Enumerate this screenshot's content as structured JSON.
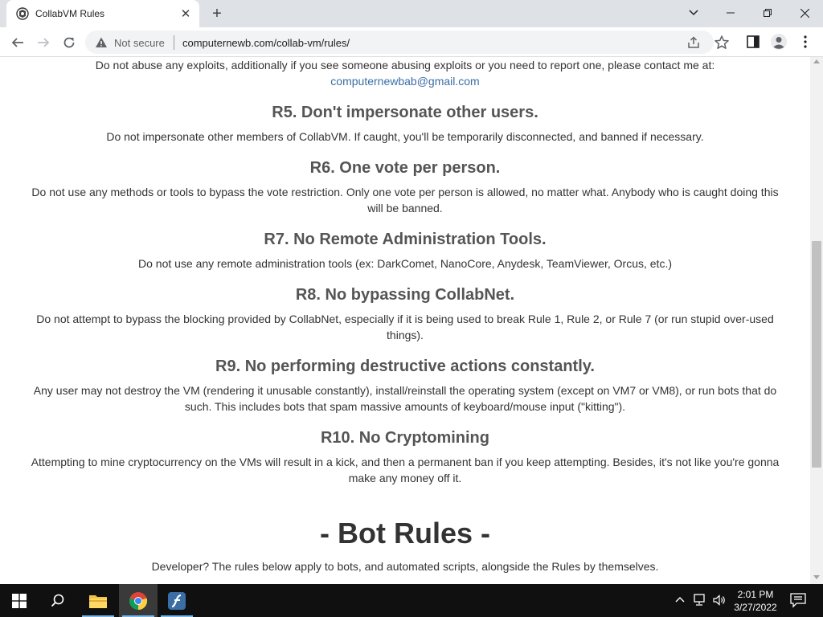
{
  "browser": {
    "tab_title": "CollabVM Rules",
    "tab_close": "✕",
    "new_tab": "+",
    "security_label": "Not secure",
    "url": "computernewb.com/collab-vm/rules/"
  },
  "page": {
    "intro_text": "Do not abuse any exploits, additionally if you see someone abusing exploits or you need to report one, please contact me at:",
    "contact_email": "computernewbab@gmail.com",
    "rules": [
      {
        "heading": "R5. Don't impersonate other users.",
        "body": "Do not impersonate other members of CollabVM. If caught, you'll be temporarily disconnected, and banned if necessary."
      },
      {
        "heading": "R6. One vote per person.",
        "body": "Do not use any methods or tools to bypass the vote restriction. Only one vote per person is allowed, no matter what. Anybody who is caught doing this will be banned."
      },
      {
        "heading": "R7. No Remote Administration Tools.",
        "body": "Do not use any remote administration tools (ex: DarkComet, NanoCore, Anydesk, TeamViewer, Orcus, etc.)"
      },
      {
        "heading": "R8. No bypassing CollabNet.",
        "body": "Do not attempt to bypass the blocking provided by CollabNet, especially if it is being used to break Rule 1, Rule 2, or Rule 7 (or run stupid over-used things)."
      },
      {
        "heading": "R9. No performing destructive actions constantly.",
        "body": "Any user may not destroy the VM (rendering it unusable constantly), install/reinstall the operating system (except on VM7 or VM8), or run bots that do such. This includes bots that spam massive amounts of keyboard/mouse input (\"kitting\")."
      },
      {
        "heading": "R10. No Cryptomining",
        "body": "Attempting to mine cryptocurrency on the VMs will result in a kick, and then a permanent ban if you keep attempting. Besides, it's not like you're gonna make any money off it."
      }
    ],
    "bot_rules_title": "- Bot Rules -",
    "bot_rules_intro": "Developer? The rules below apply to bots, and automated scripts, alongside the Rules by themselves."
  },
  "taskbar": {
    "time": "2:01 PM",
    "date": "3/27/2022"
  }
}
